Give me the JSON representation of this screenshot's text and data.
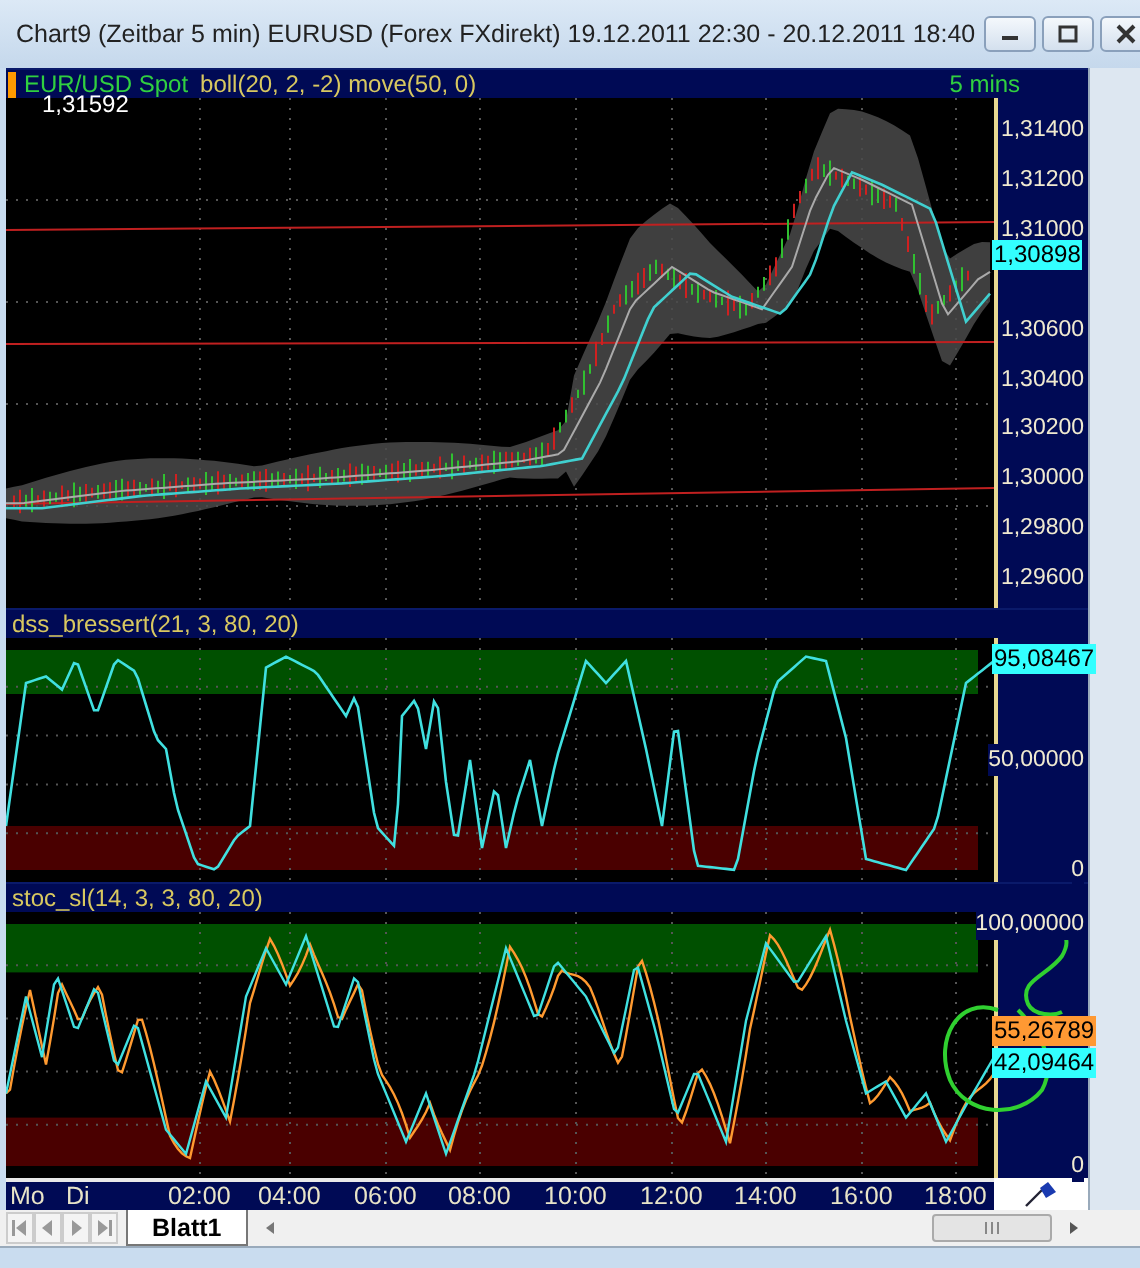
{
  "window": {
    "title": "Chart9 (Zeitbar 5 min)  EURUSD (Forex FXdirekt) 19.12.2011 22:30 - 20.12.2011 18:40"
  },
  "panels": [
    {
      "kind": "price",
      "label": "EUR/USD Spot",
      "indicators": "boll(20, 2, -2) move(50, 0)",
      "timeframe": "5 mins",
      "corner_value": "1,31592",
      "axis_labels": [
        "1,31400",
        "1,31200",
        "1,31000",
        "1,30600",
        "1,30400",
        "1,30200",
        "1,30000",
        "1,29800",
        "1,29600"
      ],
      "badges": [
        {
          "text": "1,30898",
          "color": "#33ffff"
        }
      ]
    },
    {
      "kind": "oscillator",
      "label": "dss_bressert(21, 3, 80, 20)",
      "axis_labels": [
        "50,00000",
        "0"
      ],
      "badges": [
        {
          "text": "95,08467",
          "color": "#33ffff"
        }
      ]
    },
    {
      "kind": "oscillator",
      "label": "stoc_sl(14, 3, 3, 80, 20)",
      "axis_labels": [
        "100,00000",
        "0"
      ],
      "badges": [
        {
          "text": "55,26789",
          "color": "#ff9933"
        },
        {
          "text": "42,09464",
          "color": "#33ffff"
        }
      ]
    }
  ],
  "time_axis": [
    "Mo",
    "Di",
    "02:00",
    "04:00",
    "06:00",
    "08:00",
    "10:00",
    "12:00",
    "14:00",
    "16:00",
    "18:00"
  ],
  "sheet_tabs": [
    {
      "label": "Blatt1",
      "selected": true
    }
  ]
}
